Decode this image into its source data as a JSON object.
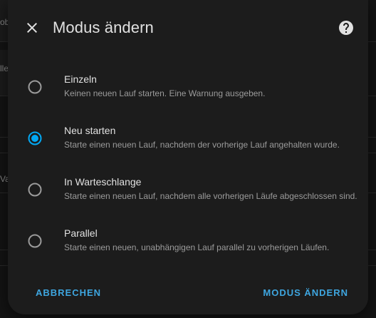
{
  "background": {
    "fragments": [
      "ob",
      "lle",
      "Va"
    ]
  },
  "dialog": {
    "title": "Modus ändern",
    "close_icon": "close-icon",
    "help_icon": "help-circle-icon",
    "selected_index": 1,
    "accent_color": "#03a9f4",
    "options": [
      {
        "label": "Einzeln",
        "description": "Keinen neuen Lauf starten. Eine Warnung ausgeben.",
        "selected": false
      },
      {
        "label": "Neu starten",
        "description": "Starte einen neuen Lauf, nachdem der vorherige Lauf angehalten wurde.",
        "selected": true
      },
      {
        "label": "In Warteschlange",
        "description": "Starte einen neuen Lauf, nachdem alle vorherigen Läufe abgeschlossen sind.",
        "selected": false
      },
      {
        "label": "Parallel",
        "description": "Starte einen neuen, unabhängigen Lauf parallel zu vorherigen Läufen.",
        "selected": false
      }
    ],
    "cancel_label": "ABBRECHEN",
    "confirm_label": "MODUS ÄNDERN"
  }
}
